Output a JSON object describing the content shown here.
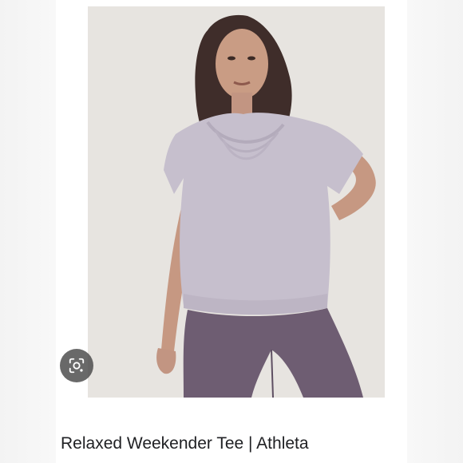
{
  "caption": {
    "title": "Relaxed Weekender Tee | Athleta"
  },
  "photo": {
    "subject": "model wearing lavender draped tee and purple leggings",
    "colors": {
      "background": "#e6e3df",
      "tee": "#c6bfcd",
      "leggings": "#6e5d72",
      "skin": "#c89a82",
      "hair": "#3f2d2a"
    }
  },
  "lens_button": {
    "icon": "visual-search-icon",
    "color": "#484848"
  }
}
